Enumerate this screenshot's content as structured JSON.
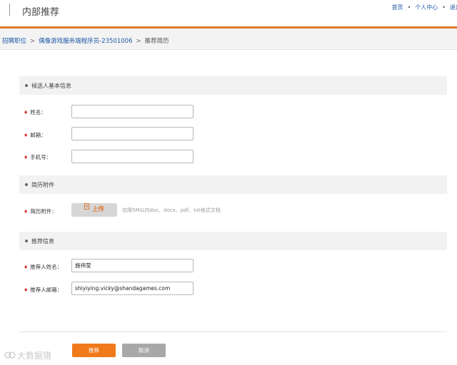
{
  "header": {
    "title": "内部推荐",
    "nav": [
      {
        "label": "首页"
      },
      {
        "label": "个人中心"
      },
      {
        "label": "退出"
      }
    ]
  },
  "breadcrumb": {
    "items": [
      "招聘职位",
      "偶像游戏服务端程序员-23501006"
    ],
    "current": "推荐简历",
    "separator": ">"
  },
  "sections": {
    "basic": "候选人基本信息",
    "resume": "简历附件",
    "referrer": "推荐信息"
  },
  "form": {
    "required_mark": "♦",
    "name_label": "姓名：",
    "email_label": "邮箱：",
    "phone_label": "手机号：",
    "attachment_label": "简历附件：",
    "upload_label": "上传",
    "upload_hint": "仅限5M以内doc、docx、pdf、txt格式文档",
    "referrer_name_label": "推荐人姓名：",
    "referrer_name_value": "施祎莹",
    "referrer_email_label": "推荐人邮箱：",
    "referrer_email_value": "shiyiying.vicky@shandagames.com"
  },
  "actions": {
    "submit_label": "推荐",
    "cancel_label": "取消"
  },
  "watermark": {
    "text": "大数据猎"
  },
  "colors": {
    "accent": "#e07a2e",
    "link": "#1f5aa6",
    "required": "#d9302c",
    "submit": "#f07a1a",
    "cancel": "#a8a8a8"
  }
}
